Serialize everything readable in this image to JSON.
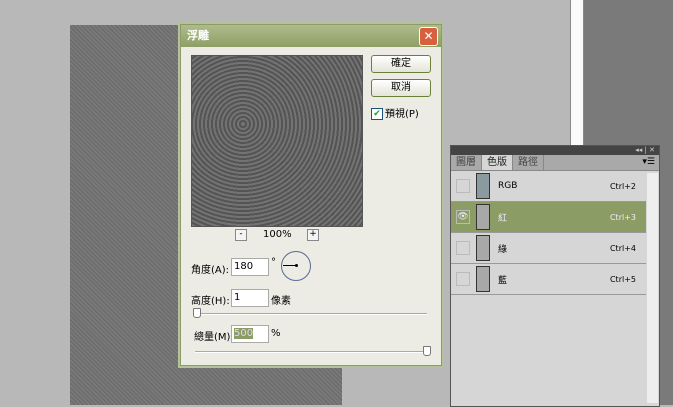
{
  "dialog": {
    "title": "浮雕",
    "ok": "確定",
    "cancel": "取消",
    "preview": "預視(P)",
    "preview_checked": true,
    "zoom": "100%",
    "zoom_out": "-",
    "zoom_in": "+",
    "angle_label": "角度(A):",
    "angle_value": "180",
    "angle_unit": "°",
    "height_label": "高度(H):",
    "height_value": "1",
    "height_unit": "像素",
    "height_slider_fraction": 0.0,
    "amount_label": "總量(M)",
    "amount_value": "500",
    "amount_unit": "%",
    "amount_slider_fraction": 1.0
  },
  "panel": {
    "tabs": [
      "圖層",
      "色版",
      "路徑"
    ],
    "active_tab": 1,
    "channels": [
      {
        "name": "RGB",
        "shortcut": "Ctrl+2",
        "visible": false
      },
      {
        "name": "紅",
        "shortcut": "Ctrl+3",
        "visible": true,
        "selected": true
      },
      {
        "name": "綠",
        "shortcut": "Ctrl+4",
        "visible": false
      },
      {
        "name": "藍",
        "shortcut": "Ctrl+5",
        "visible": false
      }
    ]
  }
}
